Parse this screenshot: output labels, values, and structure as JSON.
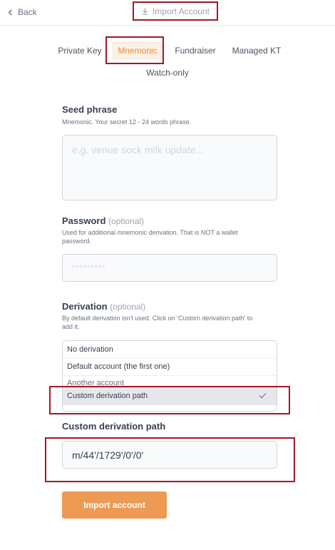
{
  "header": {
    "back_label": "Back",
    "title": "Import Account",
    "back_icon": "chevron-left-icon",
    "title_icon": "download-icon"
  },
  "tabs": [
    {
      "label": "Private Key",
      "active": false
    },
    {
      "label": "Mnemonic",
      "active": true
    },
    {
      "label": "Fundraiser",
      "active": false
    },
    {
      "label": "Managed KT",
      "active": false
    },
    {
      "label": "Watch-only",
      "active": false
    }
  ],
  "seed": {
    "label": "Seed phrase",
    "description": "Mnemonic. Your secret 12 - 24 words phrase.",
    "placeholder": "e.g. venue sock milk update..."
  },
  "password": {
    "label": "Password",
    "optional": "(optional)",
    "description": "Used for additional mnemonic derivation. That is NOT a wallet password.",
    "placeholder": "*********"
  },
  "derivation": {
    "label": "Derivation",
    "optional": "(optional)",
    "description": "By default derivation isn't used. Click on 'Custom derivation path' to add it.",
    "options": [
      "No derivation",
      "Default account (the first one)",
      "Another account",
      "Custom derivation path"
    ],
    "selected": "Custom derivation path"
  },
  "custom_path": {
    "label": "Custom derivation path",
    "value": "m/44'/1729'/0'/0'"
  },
  "submit_label": "Import account",
  "colors": {
    "accent": "#ed8936",
    "button": "#ed9a55",
    "highlight_box": "#a01826"
  }
}
